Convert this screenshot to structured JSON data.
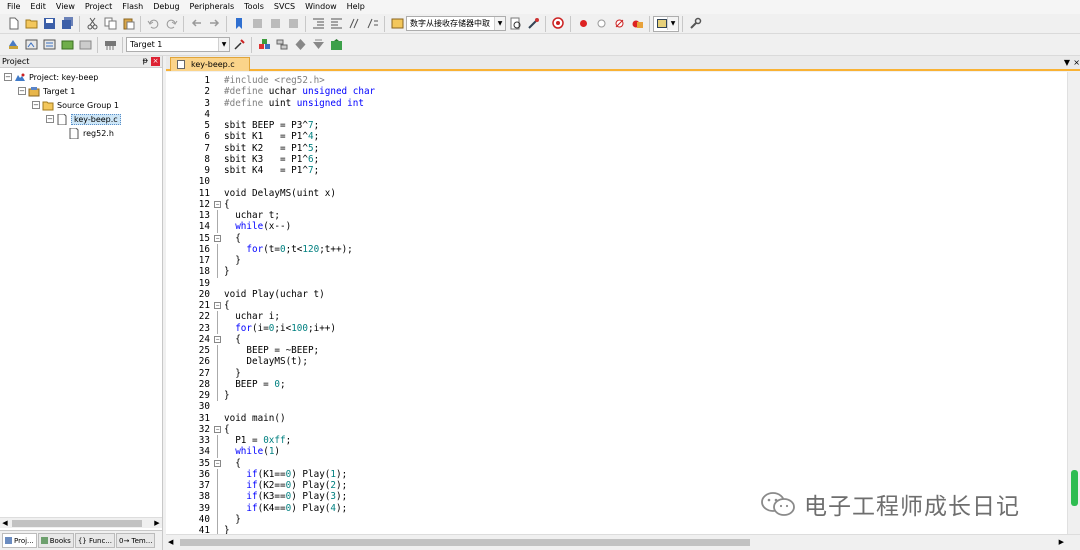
{
  "menu": [
    "File",
    "Edit",
    "View",
    "Project",
    "Flash",
    "Debug",
    "Peripherals",
    "Tools",
    "SVCS",
    "Window",
    "Help"
  ],
  "toolbar": {
    "find_combo": "数字从接收存储器中取",
    "target_combo": "Target 1"
  },
  "project_pane": {
    "title": "Project",
    "pin": "ᵽ",
    "tree": {
      "root": "Project: key-beep",
      "target": "Target 1",
      "group": "Source Group 1",
      "file": "key-beep.c",
      "header": "reg52.h"
    },
    "tabs": [
      "Proj...",
      "Books",
      "{} Func...",
      "0→ Tem..."
    ]
  },
  "editor": {
    "tab_label": "key-beep.c"
  },
  "watermark": "电子工程师成长日记",
  "icon_names": [
    "new-file-icon",
    "open-folder-icon",
    "save-icon",
    "save-all-icon",
    "cut-icon",
    "copy-icon",
    "paste-icon",
    "undo-icon",
    "redo-icon",
    "nav-back-icon",
    "nav-forward-icon",
    "bookmark-icon",
    "indent-icon",
    "outdent-icon",
    "comment-icon",
    "find-icon",
    "debug-icon",
    "breakpoint-icon",
    "build-icon",
    "rebuild-icon",
    "download-icon",
    "options-icon",
    "wrench-icon"
  ],
  "code_lines": [
    "#include <reg52.h>",
    "#define uchar unsigned char",
    "#define uint unsigned int",
    "",
    "sbit BEEP = P3^7;",
    "sbit K1   = P1^4;",
    "sbit K2   = P1^5;",
    "sbit K3   = P1^6;",
    "sbit K4   = P1^7;",
    "",
    "void DelayMS(uint x)",
    "{",
    "  uchar t;",
    "  while(x--)",
    "  {",
    "    for(t=0;t<120;t++);",
    "  }",
    "}",
    "",
    "void Play(uchar t)",
    "{",
    "  uchar i;",
    "  for(i=0;i<100;i++)",
    "  {",
    "    BEEP = ~BEEP;",
    "    DelayMS(t);",
    "  }",
    "  BEEP = 0;",
    "}",
    "",
    "void main()",
    "{",
    "  P1 = 0xff;",
    "  while(1)",
    "  {",
    "    if(K1==0) Play(1);",
    "    if(K2==0) Play(2);",
    "    if(K3==0) Play(3);",
    "    if(K4==0) Play(4);",
    "  }",
    "}"
  ],
  "colors": {
    "keyword": "#0000ff",
    "number": "#008080",
    "preprocessor": "#808080",
    "active_tab": "#fbd48a",
    "scroll_thumb": "#2fbd52"
  }
}
